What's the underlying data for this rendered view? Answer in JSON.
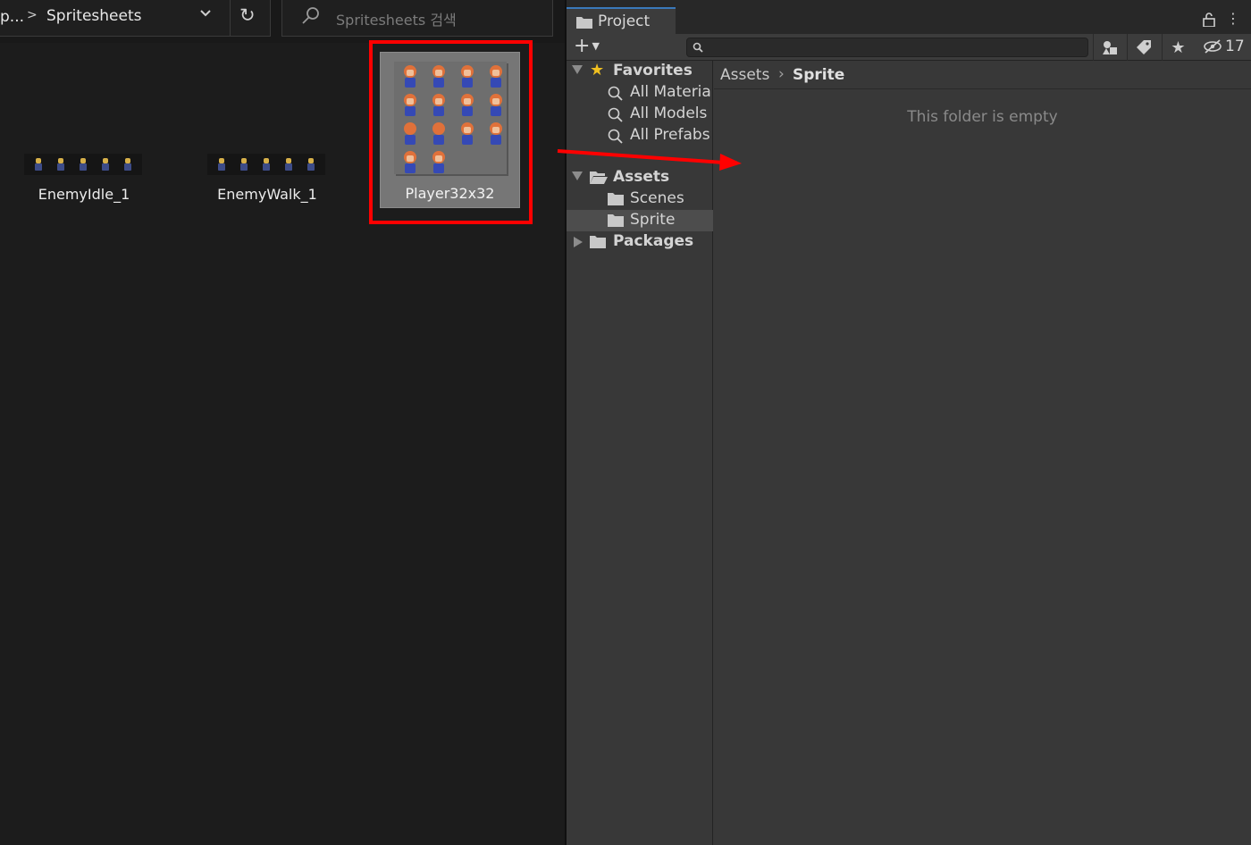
{
  "explorer": {
    "address_truncated": "p...",
    "address_current": "Spritesheets",
    "search_placeholder": "Spritesheets 검색",
    "files": [
      {
        "name": "EnemyIdle_1"
      },
      {
        "name": "EnemyWalk_1"
      },
      {
        "name": "Player32x32"
      }
    ]
  },
  "project": {
    "tab_label": "Project",
    "create_label": "+",
    "hidden_count": "17",
    "tree": {
      "favorites": "Favorites",
      "favorite_items": [
        "All Materia",
        "All Models",
        "All Prefabs"
      ],
      "assets": "Assets",
      "asset_items": [
        "Scenes",
        "Sprite"
      ],
      "packages": "Packages"
    },
    "breadcrumb": {
      "root": "Assets",
      "current": "Sprite"
    },
    "empty_message": "This folder is empty"
  },
  "colors": {
    "highlight": "#ff0000",
    "tab_accent": "#3a79bb",
    "favorite_star": "#f0c020"
  }
}
